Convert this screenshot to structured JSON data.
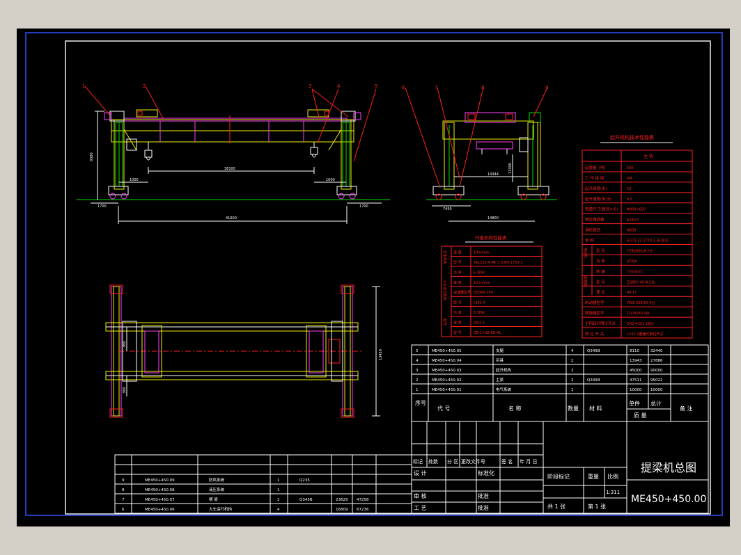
{
  "drawing": {
    "title": "提梁机总图",
    "drawing_no": "ME450+450.00",
    "balloons": [
      "1",
      "2",
      "3",
      "4",
      "5",
      "6",
      "7",
      "8",
      "9"
    ],
    "dims": {
      "height_main": "9380",
      "span_inner": "38100",
      "left_1": "1000",
      "right_1": "1000",
      "bottom_left": "1700",
      "bottom_right": "1700",
      "overall_span": "41600",
      "side_wheelbase": "14344",
      "side_left": "7450",
      "side_overall": "14800",
      "side_h": "11000",
      "plan_width": "13450",
      "plan_a": "380",
      "plan_b": "380"
    }
  },
  "hoist_table": {
    "title": "起升机构技术性能表",
    "header": "主    钩",
    "rows": [
      [
        "起重量（吨）",
        "500"
      ],
      [
        "工 作 级 别",
        "M4"
      ],
      [
        "起升高度(米)",
        "10"
      ],
      [
        "起升速度(米/分)",
        "0.5"
      ],
      [
        "卷筒尺寸(直径×长)",
        "Φ900×820"
      ],
      [
        "钢丝绳规格",
        "φ28×4"
      ],
      [
        "滑轮直径",
        "Φ830"
      ],
      [
        "钢    种",
        "6(37)-32-1770-1-光-右交"
      ],
      [
        "型    号",
        "YZR280S-8  2台"
      ],
      [
        "功    率",
        "37KW"
      ],
      [
        "转    速",
        "720r/min"
      ],
      [
        "型    号",
        "ZQ850-40-Ⅲ  2台"
      ],
      [
        "速    比",
        "40.17"
      ],
      [
        "制动器型号",
        "YWZ-300/50  4台"
      ],
      [
        "联轴器型号",
        "TLL50/80  4台"
      ],
      [
        "主钩起升限位开关",
        "DXZ-4/2(1:180)"
      ],
      [
        "限 位 开 关",
        "LX33-3重锤式限位开关"
      ]
    ],
    "group_motor": "电动机",
    "group_reducer": "减速器"
  },
  "travel_table": {
    "title": "行走机构性能表",
    "rows": [
      [
        "速    度",
        "10m/min"
      ],
      [
        "型    号",
        "YA112S-4 MP 2.5-6H-1750-1"
      ],
      [
        "功    率",
        "5.5KW"
      ],
      [
        "速    度",
        "10 m/min"
      ],
      [
        "减速器型号",
        "QS360-250"
      ],
      [
        "型    号",
        "DJ8S-4"
      ],
      [
        "功    率",
        "5.5KW"
      ],
      [
        "速    度",
        "20/2.5"
      ],
      [
        "型    号",
        "DB-1=18-6D-4L"
      ]
    ],
    "groups": [
      "行走机构",
      "小车运行机构",
      "起升"
    ]
  },
  "bom_right": {
    "rows": [
      [
        "5",
        "ME450+450.05",
        "支腿",
        "4",
        "Q345B",
        "8110",
        "32440"
      ],
      [
        "4",
        "ME450+450.04",
        "吊具",
        "2",
        "",
        "13943",
        "27886"
      ],
      [
        "3",
        "ME450+450.03",
        "起升机构",
        "2",
        "",
        "45000",
        "90000"
      ],
      [
        "2",
        "ME450+450.02",
        "主梁",
        "2",
        "Q345B",
        "47511",
        "95022"
      ],
      [
        "1",
        "ME450+450.01",
        "电气系统",
        "1",
        "",
        "10000",
        "10000"
      ]
    ],
    "header": {
      "seq": "序号",
      "code": "代      号",
      "name": "名          称",
      "qty": "数量",
      "material": "材      料",
      "unit_w": "单件",
      "total_w": "总计",
      "mass": "质      量",
      "note": "备  注"
    }
  },
  "bom_left": {
    "rows": [
      [
        "9",
        "ME450+450.09",
        "防风系统",
        "1",
        "Q235",
        "",
        ""
      ],
      [
        "8",
        "ME450+450.08",
        "液压系统",
        "1",
        "",
        "",
        ""
      ],
      [
        "7",
        "ME450+450.07",
        "横    梁",
        "2",
        "Q345B",
        "23629",
        "47258"
      ],
      [
        "6",
        "ME450+450.06",
        "大车运行机构",
        "4",
        "",
        "16809",
        "67236"
      ]
    ]
  },
  "title_block": {
    "change_labels": [
      "标记",
      "处数",
      "分  区",
      "更改文件号",
      "签 名",
      "年 月 日"
    ],
    "design": "设  计",
    "standard": "标准化",
    "check": "审  核",
    "process": "工  艺",
    "approve": "批准",
    "stage": "阶段标记",
    "weight": "重量",
    "scale": "比例",
    "scale_val": "1:311",
    "sheets": "共  1  张",
    "sheet_no": "第  1  张"
  },
  "colors": {
    "frame": "#3050ff",
    "background": "#000000",
    "line": "#ffffff",
    "red": "#ff2020",
    "yellow": "#f0f000",
    "magenta": "#ff40ff",
    "green": "#00e000",
    "cyan": "#00e8e8"
  }
}
